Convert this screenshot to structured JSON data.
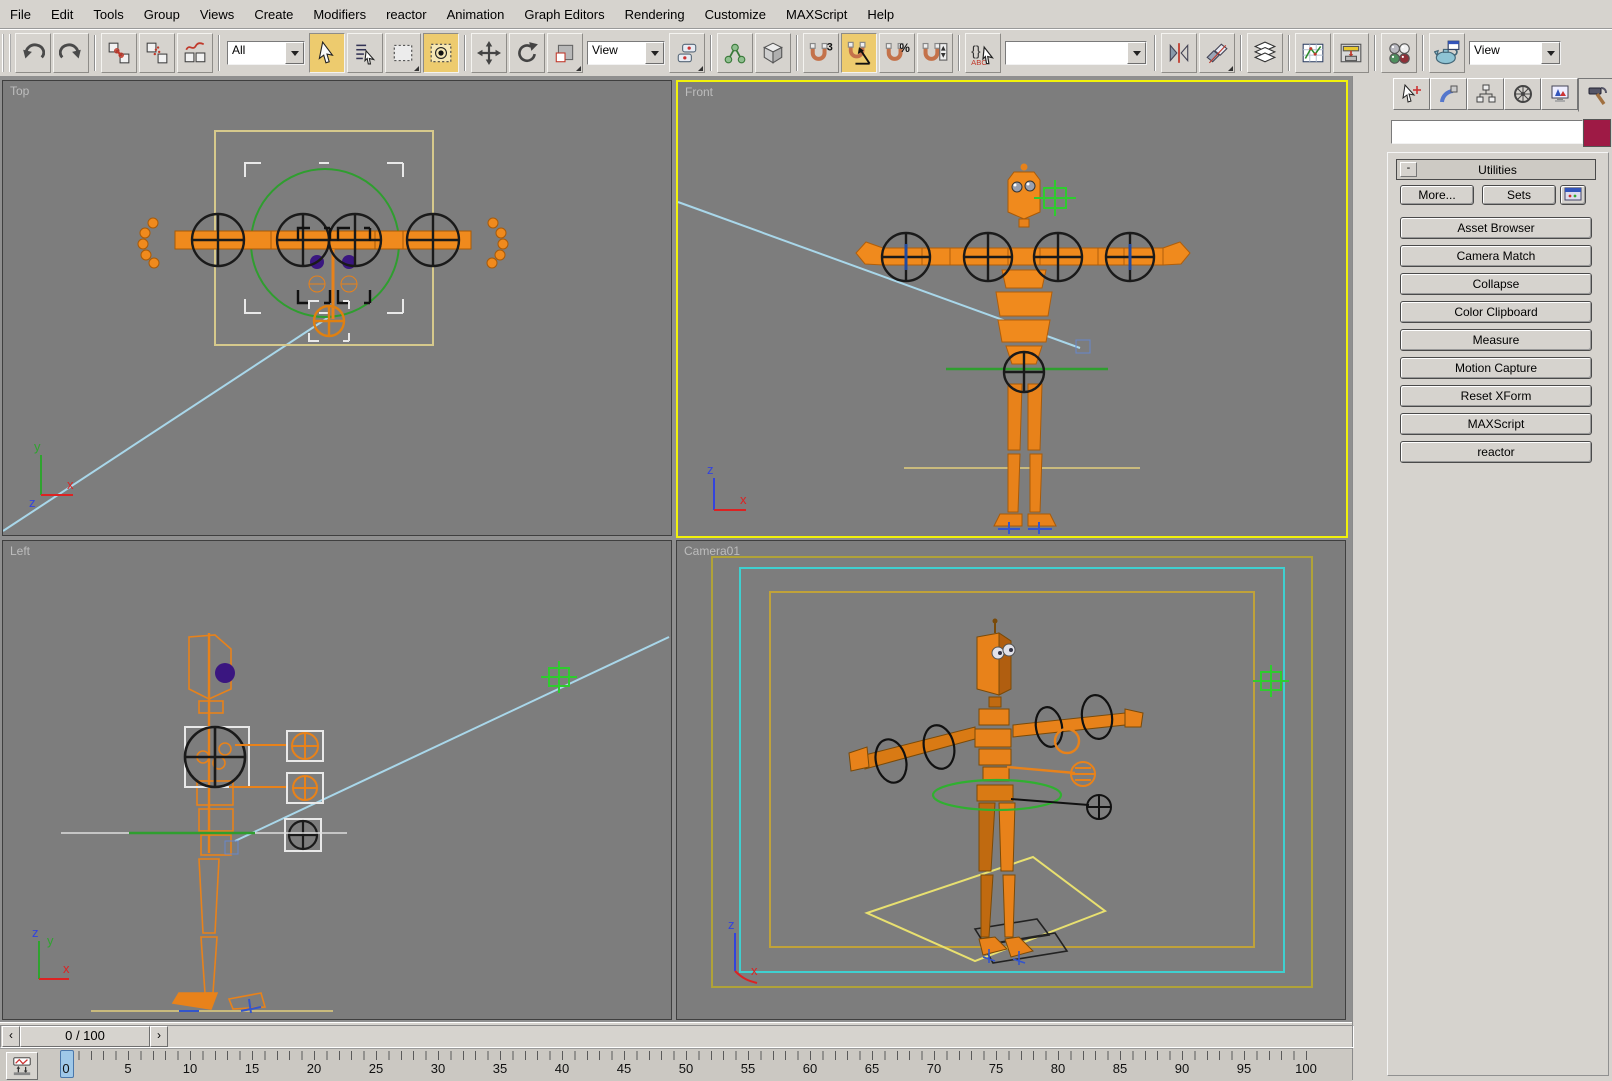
{
  "menu_bar": {
    "items": [
      "File",
      "Edit",
      "Tools",
      "Group",
      "Views",
      "Create",
      "Modifiers",
      "reactor",
      "Animation",
      "Graph Editors",
      "Rendering",
      "Customize",
      "MAXScript",
      "Help"
    ]
  },
  "toolbar": {
    "selection_filter_value": "All",
    "reference_coordinate_value": "View",
    "named_selection_value": "",
    "render_type_value": "View",
    "snap_badge_3": "3",
    "percent_glyph": "%",
    "named_sets_glyph": "{}",
    "named_sets_sub": "ABC"
  },
  "viewports": {
    "top_label": "Top",
    "front_label": "Front",
    "left_label": "Left",
    "camera_label": "Camera01",
    "axis": {
      "x": "x",
      "y": "y",
      "z": "z"
    }
  },
  "command_panel": {
    "utilities_rollout_title": "Utilities",
    "rollout_collapse_glyph": "-",
    "more_button": "More...",
    "sets_button": "Sets",
    "utility_buttons": [
      "Asset Browser",
      "Camera Match",
      "Collapse",
      "Color Clipboard",
      "Measure",
      "Motion Capture",
      "Reset XForm",
      "MAXScript",
      "reactor"
    ],
    "name_field_value": ""
  },
  "timeline": {
    "frame_display": "0 / 100",
    "prev_arrow": "‹",
    "next_arrow": "›",
    "current_frame": 0,
    "ruler": {
      "min": 0,
      "max": 100,
      "step": 5
    }
  },
  "colors": {
    "active_viewport_border": "#F2F20A",
    "viewport_background": "#7D7D7D",
    "character_orange": "#F08A1D",
    "object_color_swatch": "#9E1A45",
    "toolbar_active_background": "#EDCB6E",
    "target_line_cyan": "#A9D7EA",
    "gizmo_green": "#2F9E2F",
    "safe_frame_cyan": "#3FCFCF"
  }
}
